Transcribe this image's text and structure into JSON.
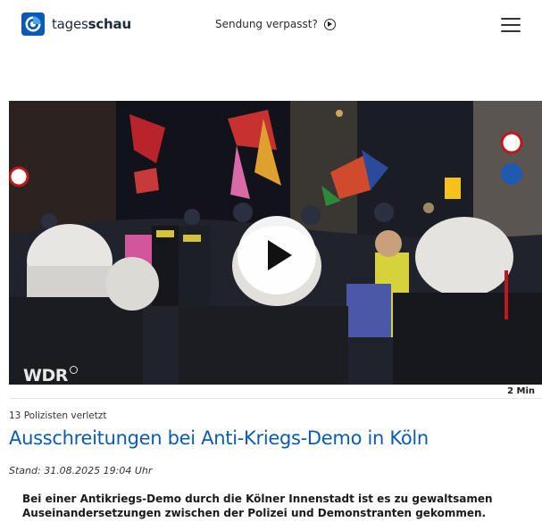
{
  "header": {
    "logo_text_light": "tages",
    "logo_text_bold": "schau",
    "sendung_label": "Sendung verpasst?",
    "icons": [
      "tagesschau-logo-icon",
      "play-circle-icon",
      "hamburger-menu-icon"
    ]
  },
  "video": {
    "channel_watermark": "WDR",
    "play_icon": "play-icon",
    "duration": "2 Min"
  },
  "article": {
    "topline": "13 Polizisten verletzt",
    "headline": "Ausschreitungen bei Anti-Kriegs-Demo in Köln",
    "stand": "Stand: 31.08.2025 19:04 Uhr",
    "teaser": "Bei einer Antikriegs-Demo durch die Kölner Innenstadt ist es zu gewaltsamen Auseinandersetzungen zwischen der Polizei und Demonstranten gekommen."
  },
  "colors": {
    "brand_blue": "#0a5bb5",
    "text": "#1a1a1a"
  }
}
